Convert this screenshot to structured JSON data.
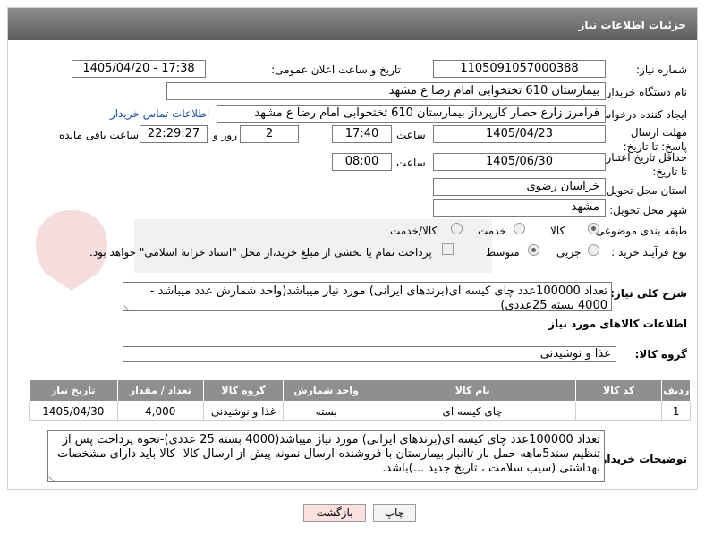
{
  "header": {
    "title": "جزئیات اطلاعات نیاز"
  },
  "fields": {
    "need_number_label": "شماره نیاز:",
    "need_number": "1105091057000388",
    "announce_label": "تاریخ و ساعت اعلان عمومی:",
    "announce_value": "1405/04/20 - 17:38",
    "buyer_org_label": "نام دستگاه خریدار:",
    "buyer_org": "بیمارستان 610 تختخوابی امام رضا ع  مشهد",
    "creator_label": "ایجاد کننده درخواست:",
    "creator": "فرامرز زارع حصار کارپرداز بیمارستان 610 تختخوابی امام رضا ع  مشهد",
    "contact_link": "اطلاعات تماس خریدار",
    "deadline_label": "مهلت ارسال پاسخ: تا تاریخ:",
    "deadline_date": "1405/04/23",
    "time_label": "ساعت",
    "deadline_time": "17:40",
    "days_value": "2",
    "days_label": "روز و",
    "remaining_time": "22:29:27",
    "remaining_label": "ساعت باقی مانده",
    "min_price_label": "حداقل تاریخ اعتبار قیمت: تا تاریخ:",
    "min_price_date": "1405/06/30",
    "min_price_time": "08:00",
    "province_label": "استان محل تحویل:",
    "province": "خراسان رضوی",
    "city_label": "شهر محل تحویل:",
    "city": "مشهد",
    "category_label": "طبقه بندی موضوعی:",
    "category_options": [
      "کالا",
      "خدمت",
      "کالا/خدمت"
    ],
    "process_label": "نوع فرآیند خرید :",
    "process_options": [
      "جزیی",
      "متوسط"
    ],
    "payment_text": "پرداخت تمام یا بخشی از مبلغ خرید،از محل \"اسناد خزانه اسلامی\" خواهد بود."
  },
  "description": {
    "label": "شرح کلی نیاز:",
    "text": "تعداد 100000عدد چای کیسه ای(برندهای ایرانی) مورد نیاز میباشد(واحد شمارش عدد میباشد - 4000 بسته 25عددی)"
  },
  "goods_section": {
    "title": "اطلاعات کالاهای مورد نیاز",
    "group_label": "گروه کالا:",
    "group_value": "غذا و نوشیدنی"
  },
  "table": {
    "headers": [
      "ردیف",
      "کد کالا",
      "نام کالا",
      "واحد شمارش",
      "گروه کالا",
      "تعداد / مقدار",
      "تاریخ نیاز"
    ],
    "rows": [
      [
        "1",
        "--",
        "چای کیسه ای",
        "بسته",
        "غذا و نوشیدنی",
        "4,000",
        "1405/04/30"
      ]
    ]
  },
  "buyer_notes": {
    "label": "توضیحات خریدار:",
    "text": "تعداد 100000عدد چای کیسه ای(برندهای ایرانی) مورد نیاز میباشد(4000 بسته 25 عددی)-نحوه پرداخت پس از تنظیم سند5ماهه-حمل  بار تاانبار بیمارستان با فروشنده-ارسال نمونه پیش از ارسال کالا- کالا باید دارای مشخصات بهداشتی (سیب سلامت ، تاریخ جدید  ...)باشد."
  },
  "buttons": {
    "print": "چاپ",
    "back": "بازگشت"
  },
  "colors": {
    "header_bg": "#777777",
    "link": "#1a4fa3",
    "back_button": "#fbe0e0"
  }
}
